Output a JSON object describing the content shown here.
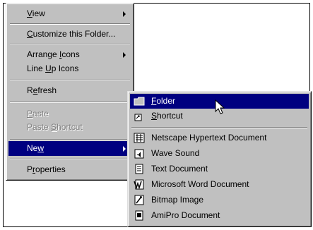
{
  "context_menu": {
    "items": [
      {
        "label": "View",
        "accel": "V",
        "rest": "iew",
        "pre": ""
      },
      {
        "label": "Customize this Folder...",
        "pre": "",
        "accel": "C",
        "rest": "ustomize this Folder..."
      },
      {
        "label": "Arrange Icons",
        "pre": "Arrange ",
        "accel": "I",
        "rest": "cons"
      },
      {
        "label": "Line Up Icons",
        "pre": "Line ",
        "accel": "U",
        "rest": "p Icons"
      },
      {
        "label": "Refresh",
        "pre": "R",
        "accel": "e",
        "rest": "fresh"
      },
      {
        "label": "Paste",
        "pre": "",
        "accel": "P",
        "rest": "aste"
      },
      {
        "label": "Paste Shortcut",
        "pre": "Paste ",
        "accel": "S",
        "rest": "hortcut"
      },
      {
        "label": "New",
        "pre": "Ne",
        "accel": "w",
        "rest": ""
      },
      {
        "label": "Properties",
        "pre": "P",
        "accel": "r",
        "rest": "operties"
      }
    ]
  },
  "new_submenu": {
    "items": [
      {
        "label": "Folder",
        "pre": "",
        "accel": "F",
        "rest": "older",
        "icon": "folder-icon"
      },
      {
        "label": "Shortcut",
        "pre": "",
        "accel": "S",
        "rest": "hortcut",
        "icon": "shortcut-icon"
      },
      {
        "label": "Netscape Hypertext Document",
        "icon": "netscape-document-icon"
      },
      {
        "label": "Wave Sound",
        "icon": "wave-sound-icon"
      },
      {
        "label": "Text Document",
        "icon": "text-document-icon"
      },
      {
        "label": "Microsoft Word Document",
        "icon": "word-document-icon"
      },
      {
        "label": "Bitmap Image",
        "icon": "bitmap-image-icon"
      },
      {
        "label": "AmiPro Document",
        "icon": "amipro-document-icon"
      }
    ]
  },
  "colors": {
    "menu_face": "#c0c0c0",
    "highlight": "#000080",
    "disabled_text": "#808080"
  }
}
